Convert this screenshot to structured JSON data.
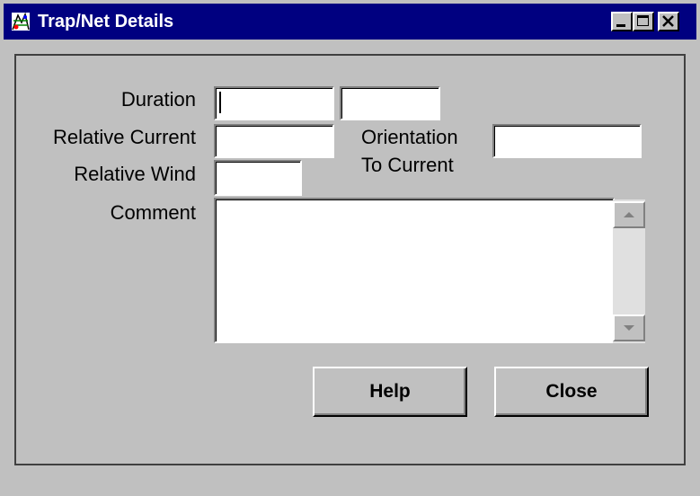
{
  "window": {
    "title": "Trap/Net Details",
    "icon": "app-net-icon",
    "controls": [
      "minimize-icon",
      "maximize-icon",
      "close-icon"
    ]
  },
  "form": {
    "duration_label": "Duration",
    "duration_value_1": "",
    "duration_value_2": "",
    "relative_current_label": "Relative Current",
    "relative_current_value": "",
    "orientation_label_line1": "Orientation",
    "orientation_label_line2": "To Current",
    "orientation_value": "",
    "relative_wind_label": "Relative Wind",
    "relative_wind_value": "",
    "comment_label": "Comment",
    "comment_value": ""
  },
  "buttons": {
    "help_label": "Help",
    "close_label": "Close"
  },
  "colors": {
    "titlebar": "#000080",
    "face": "#c0c0c0"
  }
}
